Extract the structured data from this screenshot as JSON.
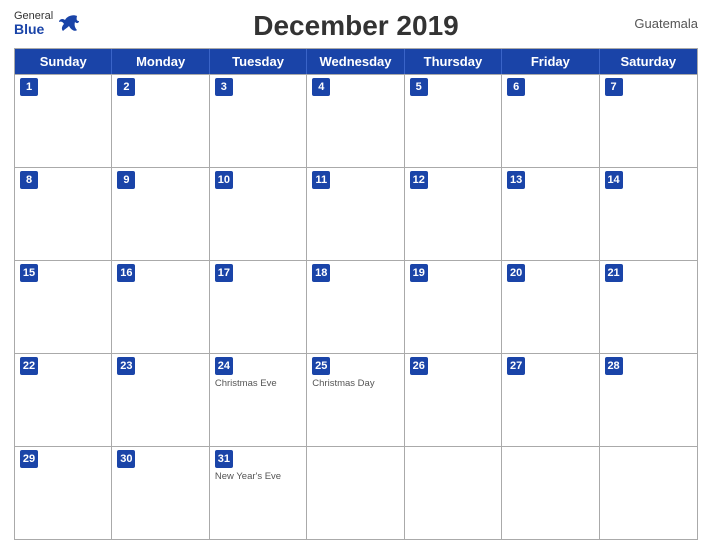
{
  "header": {
    "title": "December 2019",
    "country": "Guatemala",
    "logo_general": "General",
    "logo_blue": "Blue"
  },
  "weekdays": [
    "Sunday",
    "Monday",
    "Tuesday",
    "Wednesday",
    "Thursday",
    "Friday",
    "Saturday"
  ],
  "weeks": [
    [
      {
        "day": 1,
        "events": []
      },
      {
        "day": 2,
        "events": []
      },
      {
        "day": 3,
        "events": []
      },
      {
        "day": 4,
        "events": []
      },
      {
        "day": 5,
        "events": []
      },
      {
        "day": 6,
        "events": []
      },
      {
        "day": 7,
        "events": []
      }
    ],
    [
      {
        "day": 8,
        "events": []
      },
      {
        "day": 9,
        "events": []
      },
      {
        "day": 10,
        "events": []
      },
      {
        "day": 11,
        "events": []
      },
      {
        "day": 12,
        "events": []
      },
      {
        "day": 13,
        "events": []
      },
      {
        "day": 14,
        "events": []
      }
    ],
    [
      {
        "day": 15,
        "events": []
      },
      {
        "day": 16,
        "events": []
      },
      {
        "day": 17,
        "events": []
      },
      {
        "day": 18,
        "events": []
      },
      {
        "day": 19,
        "events": []
      },
      {
        "day": 20,
        "events": []
      },
      {
        "day": 21,
        "events": []
      }
    ],
    [
      {
        "day": 22,
        "events": []
      },
      {
        "day": 23,
        "events": []
      },
      {
        "day": 24,
        "events": [
          "Christmas Eve"
        ]
      },
      {
        "day": 25,
        "events": [
          "Christmas Day"
        ]
      },
      {
        "day": 26,
        "events": []
      },
      {
        "day": 27,
        "events": []
      },
      {
        "day": 28,
        "events": []
      }
    ],
    [
      {
        "day": 29,
        "events": []
      },
      {
        "day": 30,
        "events": []
      },
      {
        "day": 31,
        "events": [
          "New Year's Eve"
        ]
      },
      {
        "day": null,
        "events": []
      },
      {
        "day": null,
        "events": []
      },
      {
        "day": null,
        "events": []
      },
      {
        "day": null,
        "events": []
      }
    ]
  ]
}
